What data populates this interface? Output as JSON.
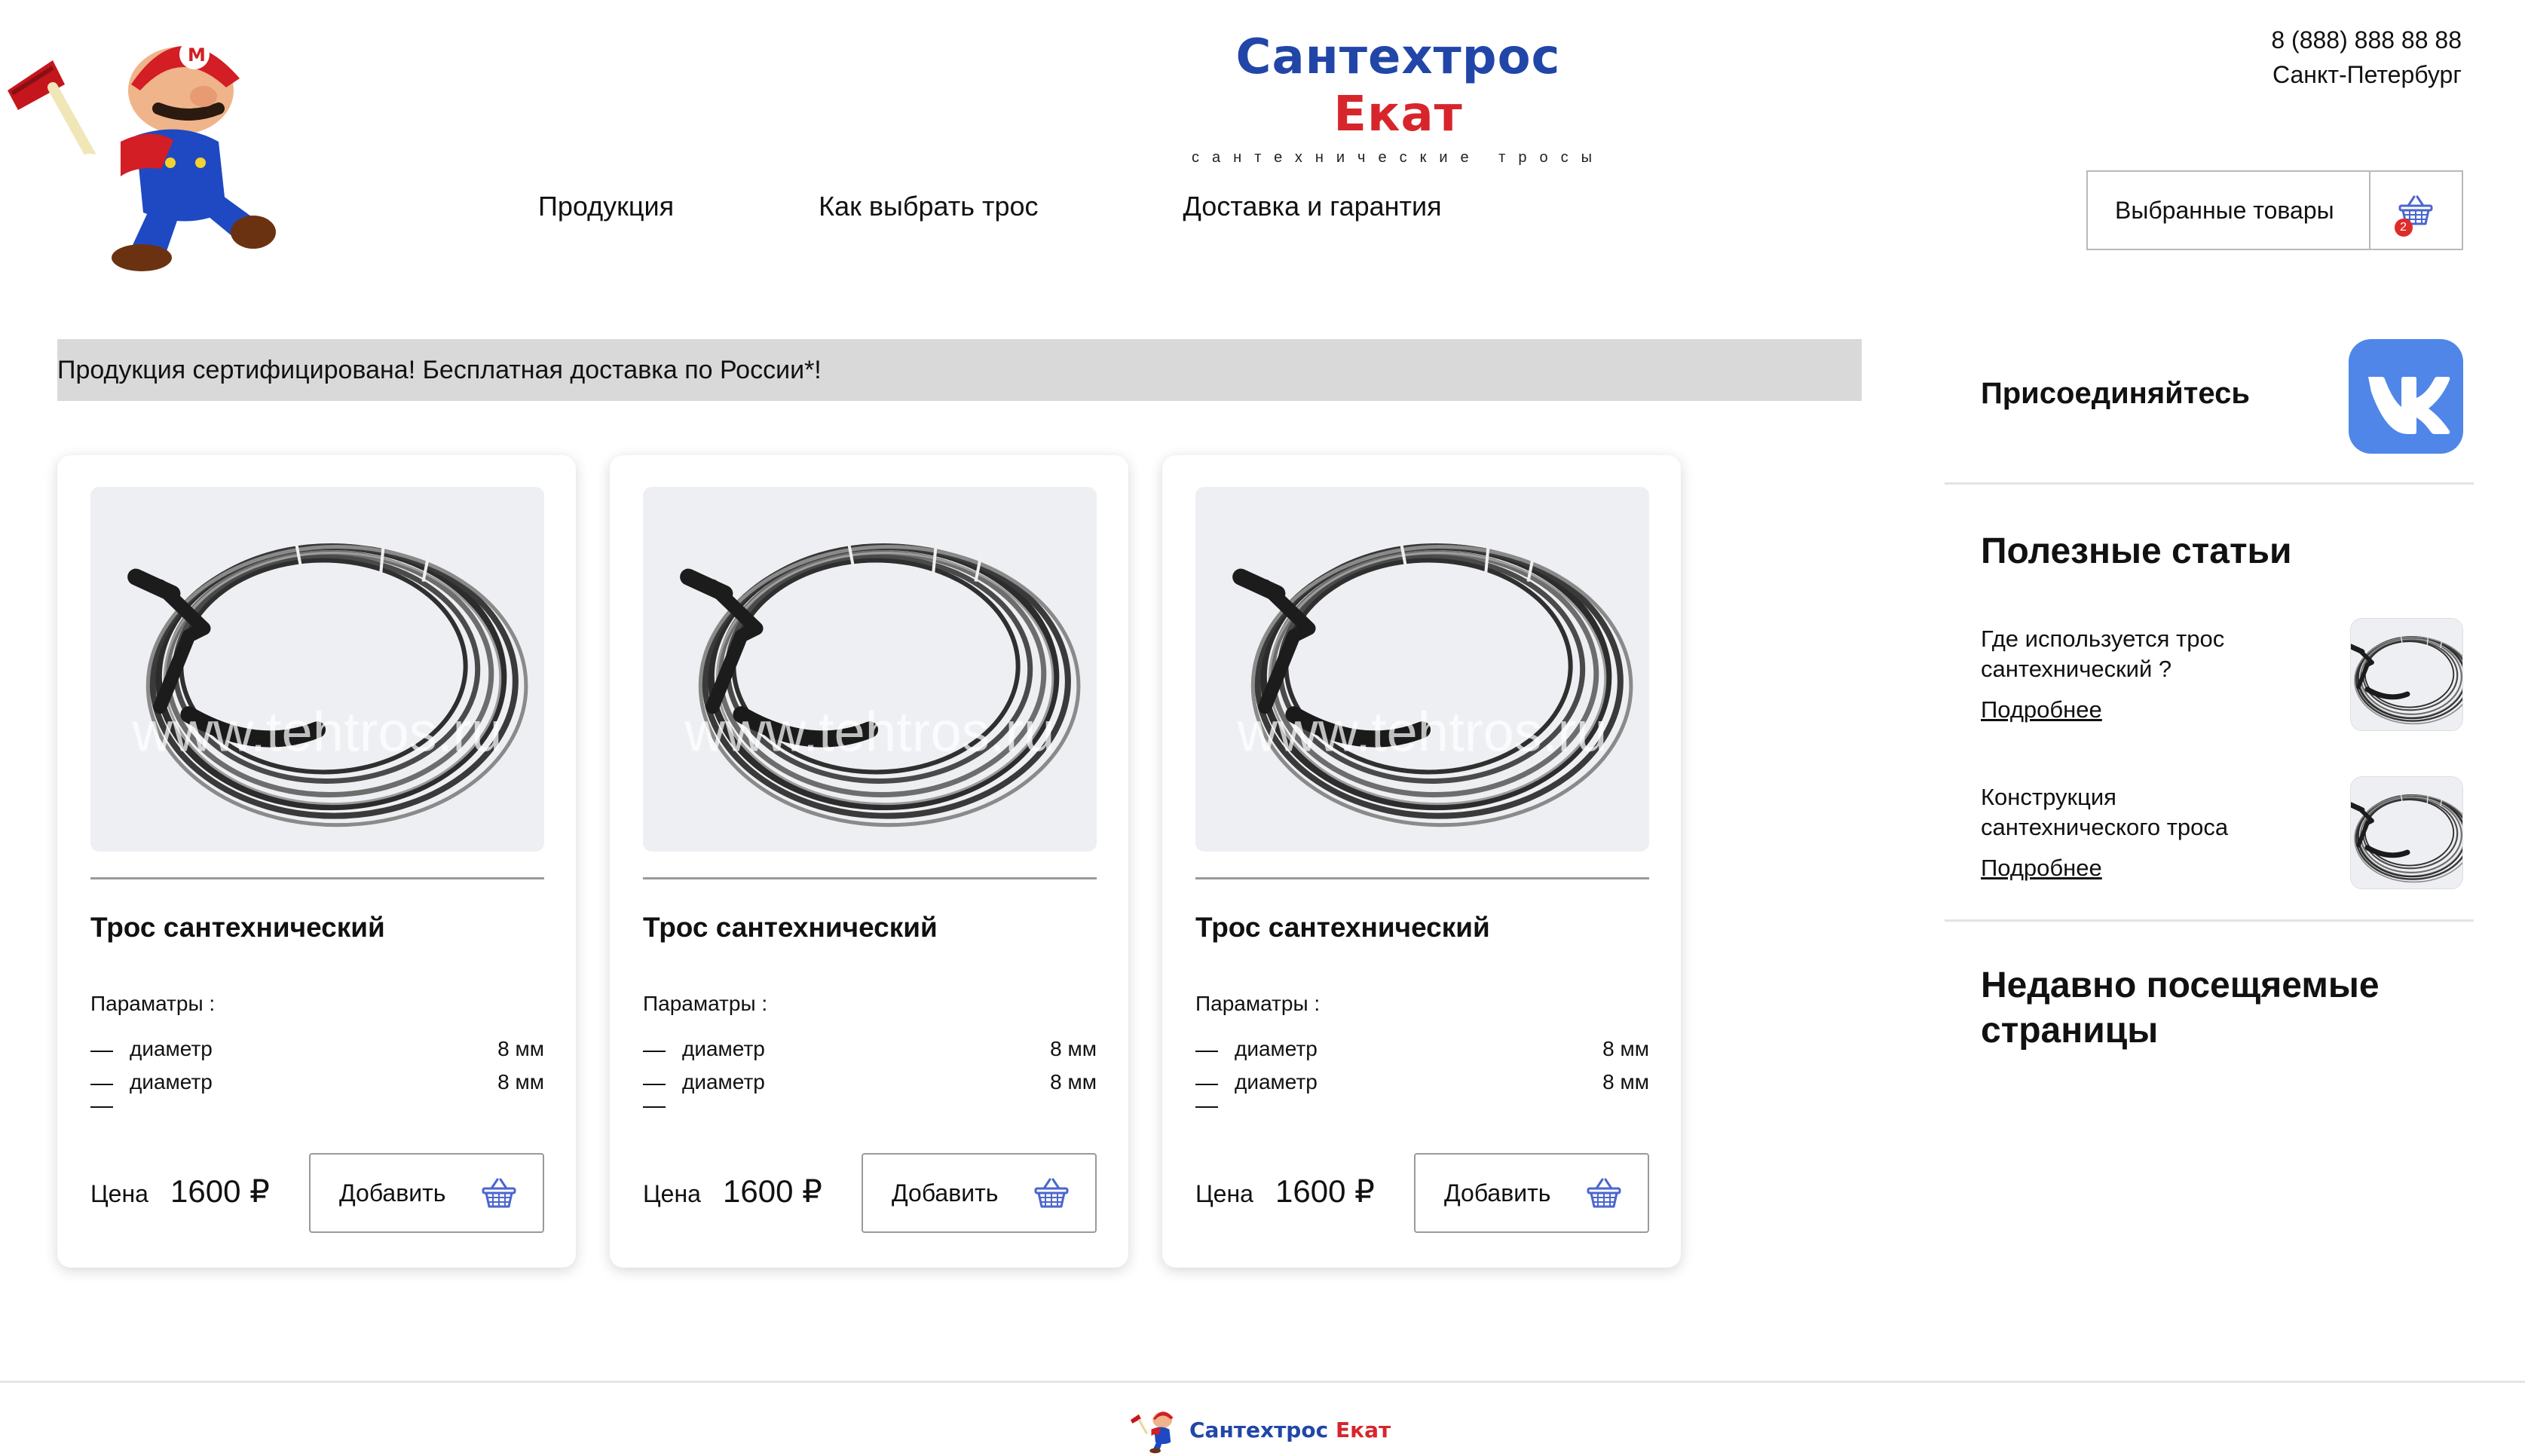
{
  "brand": {
    "name_part1": "Сантехтрос",
    "name_part2": "Екат",
    "tagline": "сантехнические тросы"
  },
  "contacts": {
    "phone": "8 (888) 888 88 88",
    "city": "Санкт-Петербург"
  },
  "nav": {
    "items": [
      {
        "label": "Продукция"
      },
      {
        "label": "Как выбрать трос"
      },
      {
        "label": "Доставка и гарантия"
      }
    ]
  },
  "cart": {
    "label": "Выбранные товары",
    "count": "2",
    "icon": "basket-icon"
  },
  "banner": {
    "text": "Продукция сертифицирована! Бесплатная доставка по России*!"
  },
  "products": [
    {
      "watermark": "www.tehtros.ru",
      "title": "Трос сантехнический",
      "params_title": "Параматры :",
      "params": [
        {
          "name": "диаметр",
          "value": "8 мм"
        },
        {
          "name": "диаметр",
          "value": "8 мм"
        }
      ],
      "price_label": "Цена",
      "price": "1600 ₽",
      "add_label": "Добавить"
    },
    {
      "watermark": "www.tehtros.ru",
      "title": "Трос сантехнический",
      "params_title": "Параматры :",
      "params": [
        {
          "name": "диаметр",
          "value": "8 мм"
        },
        {
          "name": "диаметр",
          "value": "8 мм"
        }
      ],
      "price_label": "Цена",
      "price": "1600 ₽",
      "add_label": "Добавить"
    },
    {
      "watermark": "www.tehtros.ru",
      "title": "Трос сантехнический",
      "params_title": "Параматры :",
      "params": [
        {
          "name": "диаметр",
          "value": "8 мм"
        },
        {
          "name": "диаметр",
          "value": "8 мм"
        }
      ],
      "price_label": "Цена",
      "price": "1600 ₽",
      "add_label": "Добавить"
    }
  ],
  "sidebar": {
    "join": "Присоединяйтесь",
    "vk_icon": "vk-icon",
    "articles_title": "Полезные статьи",
    "articles": [
      {
        "title": "Где используется трос сантехнический ?",
        "link": "Подробнее"
      },
      {
        "title": "Конструкция сантехнического троса",
        "link": "Подробнее"
      }
    ],
    "recent_title": "Недавно посещяемые страницы"
  },
  "footer": {
    "name_part1": "Сантехтрос",
    "name_part2": "Екат"
  },
  "colors": {
    "brand_blue": "#2146a8",
    "brand_red": "#d6262c",
    "vk_blue": "#4f86e8",
    "banner_gray": "#d9d9d9",
    "badge_red": "#e12a2a"
  }
}
